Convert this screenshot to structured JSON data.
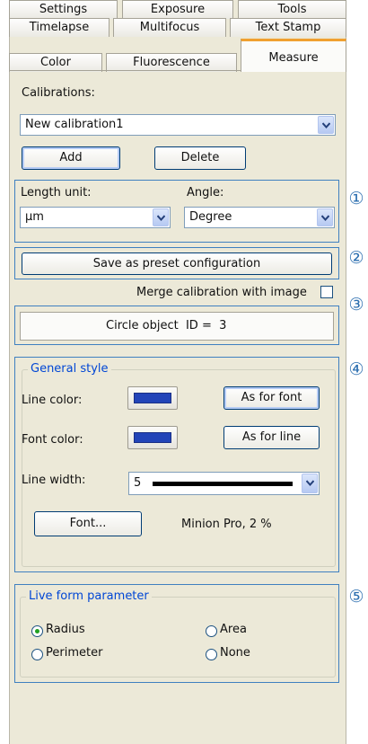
{
  "tabs": {
    "row1": [
      "Settings",
      "Exposure",
      "Tools"
    ],
    "row2": [
      "Timelapse",
      "Multifocus",
      "Text Stamp"
    ],
    "row3": [
      "Color",
      "Fluorescence",
      "Measure"
    ],
    "active": "Measure",
    "active_color": "#f0a030"
  },
  "calibrations": {
    "label": "Calibrations:",
    "selected": "New calibration1",
    "add_label": "Add",
    "delete_label": "Delete"
  },
  "units": {
    "length_label": "Length unit:",
    "length_value": "µm",
    "angle_label": "Angle:",
    "angle_value": "Degree"
  },
  "preset": {
    "save_label": "Save as preset configuration",
    "merge_label": "Merge calibration with image",
    "merge_checked": false
  },
  "object_info": {
    "text": "Circle object  ID =  3"
  },
  "general_style": {
    "title": "General style",
    "line_color_label": "Line color:",
    "line_color": "#2244b8",
    "as_for_font_label": "As for font",
    "font_color_label": "Font color:",
    "font_color": "#2244b8",
    "as_for_line_label": "As for line",
    "line_width_label": "Line width:",
    "line_width_value": "5",
    "font_button_label": "Font...",
    "font_info": "Minion Pro, 2 %"
  },
  "live_form": {
    "title": "Live form parameter",
    "options": [
      {
        "label": "Radius",
        "selected": true
      },
      {
        "label": "Area",
        "selected": false
      },
      {
        "label": "Perimeter",
        "selected": false
      },
      {
        "label": "None",
        "selected": false
      }
    ]
  },
  "markers": [
    "①",
    "②",
    "③",
    "④",
    "⑤"
  ],
  "colors": {
    "panel_bg": "#ece9d8",
    "frame_blue": "#3f80c0",
    "group_title_blue": "#0046d5"
  }
}
